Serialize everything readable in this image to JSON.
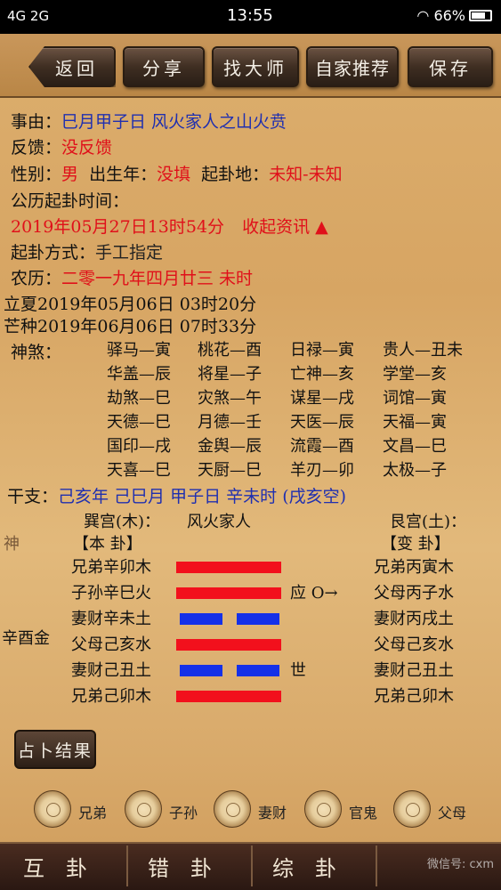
{
  "status": {
    "left": "4G 2G",
    "time": "13:55",
    "battery": "66%"
  },
  "toolbar": {
    "back": "返回",
    "share": "分享",
    "find_master": "找大师",
    "recommend": "自家推荐",
    "save": "保存"
  },
  "info": {
    "matter_label": "事由：",
    "matter_value": "巳月甲子日 风火家人之山火贲",
    "feedback_label": "反馈：",
    "feedback_value": "没反馈",
    "gender_label": "性别：",
    "gender_value": "男",
    "birth_label": "出生年：",
    "birth_value": "没填",
    "place_label": "起卦地：",
    "place_value": "未知-未知",
    "time_label": "公历起卦时间：",
    "time_value": "2019年05月27日13时54分",
    "collect": "收起资讯",
    "collect_arrow": "▲",
    "method_label": "起卦方式：",
    "method_value": "手工指定",
    "lunar_label": "农历：",
    "lunar_value": "二零一九年四月廿三 未时",
    "lixia": "立夏2019年05月06日 03时20分",
    "mangzhong": "芒种2019年06月06日 07时33分"
  },
  "shensha": {
    "label": "神煞：",
    "rows": [
      [
        "驿马—寅",
        "桃花—酉",
        "日禄—寅",
        "贵人—丑未"
      ],
      [
        "华盖—辰",
        "将星—子",
        "亡神—亥",
        "学堂—亥"
      ],
      [
        "劫煞—巳",
        "灾煞—午",
        "谋星—戌",
        "词馆—寅"
      ],
      [
        "天德—巳",
        "月德—壬",
        "天医—辰",
        "天福—寅"
      ],
      [
        "国印—戌",
        "金舆—辰",
        "流霞—酉",
        "文昌—巳"
      ],
      [
        "天喜—巳",
        "天厨—巳",
        "羊刃—卯",
        "太极—子"
      ]
    ]
  },
  "ganzhi": {
    "label": "干支：",
    "value": "己亥年 己巳月 甲子日 辛未时",
    "kong": "(戌亥空)"
  },
  "gua": {
    "left_palace": "巽宫(木)：",
    "left_name": "风火家人",
    "right_palace": "艮宫(土)：",
    "ben_label": "【本 卦】",
    "bian_label": "【变 卦】",
    "shen_label": "神",
    "fu_label": "辛酉金",
    "ben_lines": [
      "兄弟辛卯木",
      "子孙辛巳火",
      "妻财辛未土",
      "父母己亥水",
      "妻财己丑土",
      "兄弟己卯木"
    ],
    "ben_types": [
      "yang",
      "yang",
      "yin",
      "yang",
      "yin",
      "yang"
    ],
    "marks": [
      "",
      "应 O→",
      "",
      "",
      "世",
      ""
    ],
    "bian_lines": [
      "兄弟丙寅木",
      "父母丙子水",
      "妻财丙戌土",
      "父母己亥水",
      "妻财己丑土",
      "兄弟己卯木"
    ]
  },
  "result_button": "占卜结果",
  "radios": [
    "兄弟",
    "子孙",
    "妻财",
    "官鬼",
    "父母"
  ],
  "bottom_tabs": [
    "互卦",
    "错卦",
    "综卦"
  ],
  "watermark": "微信号: cxm"
}
